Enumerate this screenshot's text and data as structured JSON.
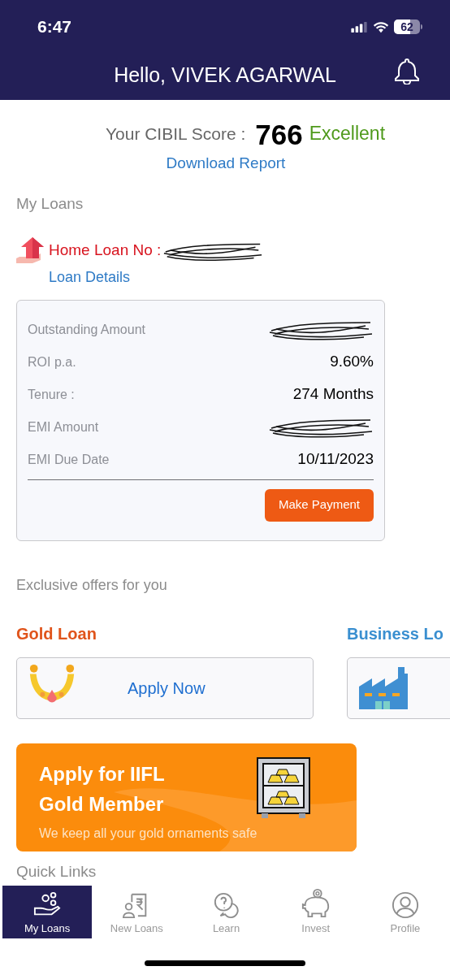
{
  "status_bar": {
    "time": "6:47",
    "battery": "62"
  },
  "header": {
    "greeting": "Hello, VIVEK AGARWAL"
  },
  "cibil": {
    "label": "Your CIBIL Score :",
    "score": "766",
    "rating": "Excellent",
    "link": "Download Report"
  },
  "my_loans": {
    "title": "My Loans",
    "loan_title": "Home Loan No :",
    "loan_number_redacted": true,
    "link": "Loan Details",
    "details": [
      {
        "label": "Outstanding Amount",
        "redacted": true
      },
      {
        "label": "ROI p.a.",
        "value": "9.60%"
      },
      {
        "label": "Tenure :",
        "value": "274 Months"
      },
      {
        "label": "EMI Amount",
        "redacted": true
      },
      {
        "label": "EMI Due Date",
        "value": "10/11/2023"
      }
    ],
    "button": "Make Payment"
  },
  "offers": {
    "title": "Exclusive offers for you",
    "items": [
      {
        "kind": "gold",
        "title": "Gold Loan",
        "action": "Apply Now"
      },
      {
        "kind": "business",
        "title": "Business Lo"
      }
    ]
  },
  "banner": {
    "title": "Apply for IIFL",
    "title_line2": "Gold Member",
    "subtitle": "We keep all your gold ornaments safe"
  },
  "quick_links": {
    "title": "Quick Links"
  },
  "nav": [
    {
      "kind": "loans",
      "label": "My Loans",
      "selected": true
    },
    {
      "kind": "new",
      "label": "New Loans",
      "selected": false
    },
    {
      "kind": "learn",
      "label": "Learn",
      "selected": false
    },
    {
      "kind": "invest",
      "label": "Invest",
      "selected": false
    },
    {
      "kind": "profile",
      "label": "Profile",
      "selected": false
    }
  ]
}
